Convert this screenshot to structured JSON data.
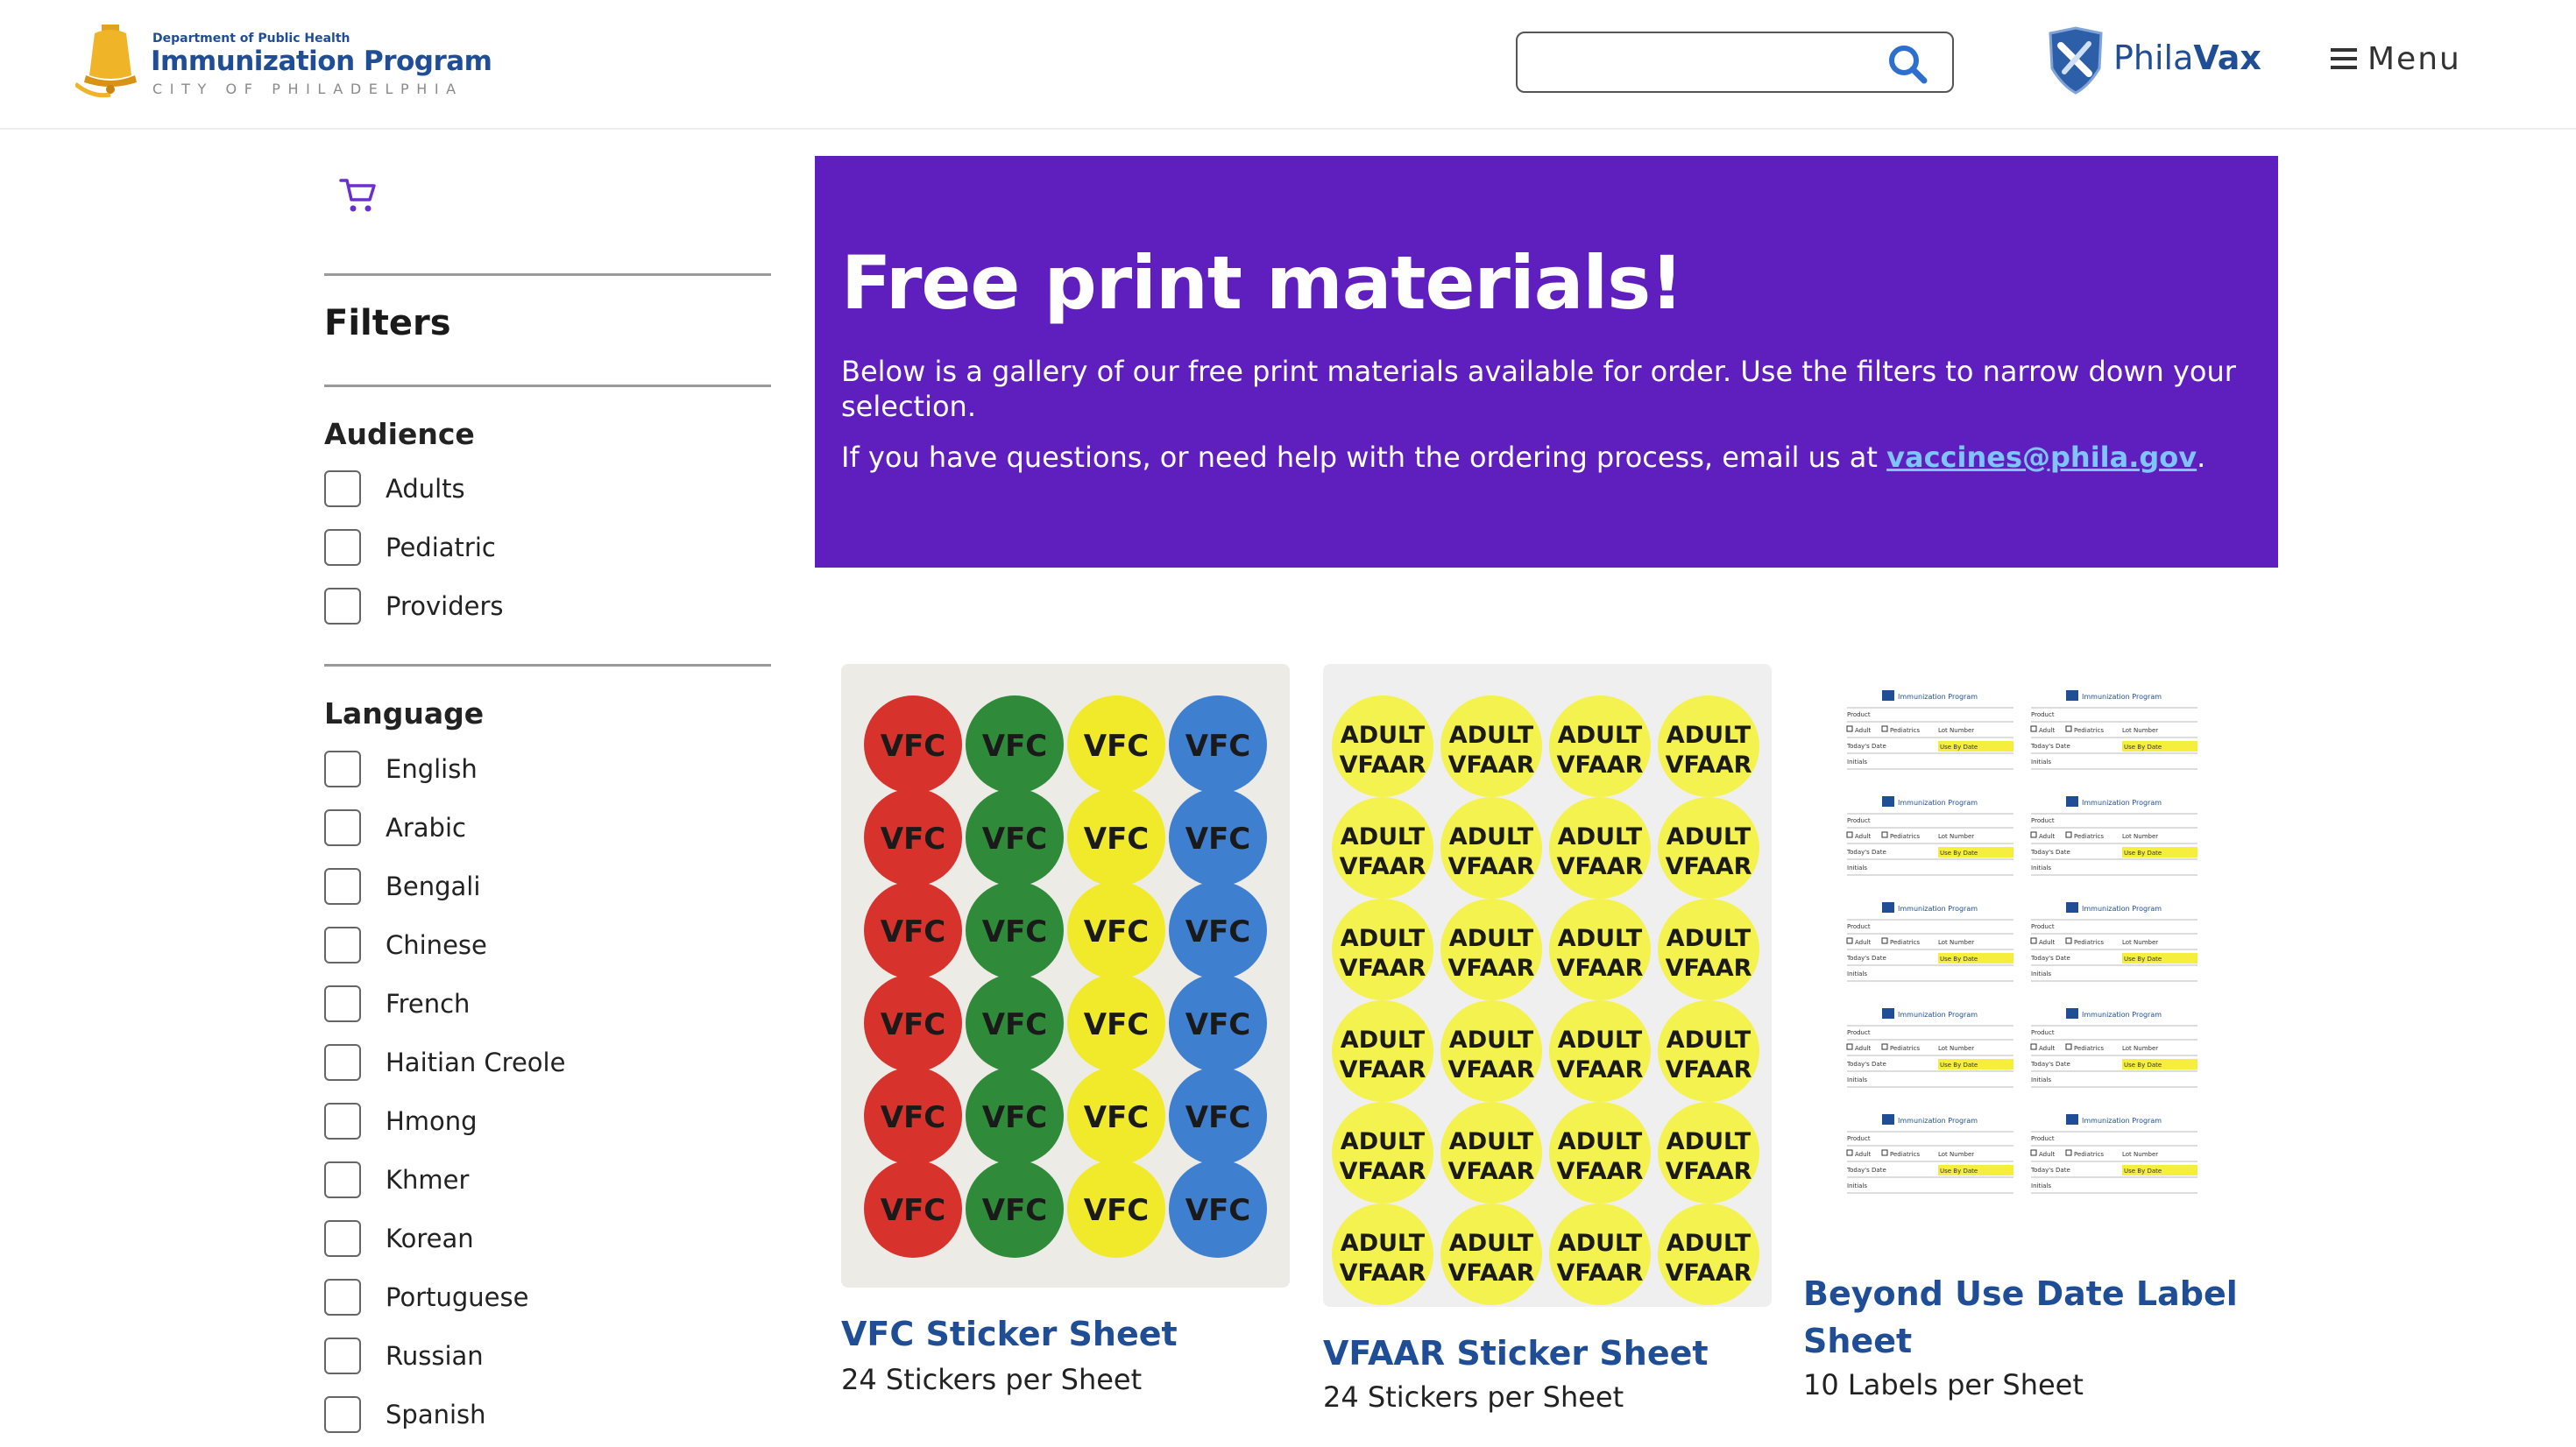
{
  "header": {
    "logo": {
      "department": "Department of Public Health",
      "program": "Immunization Program",
      "city": "CITY OF PHILADELPHIA"
    },
    "search": {
      "value": "",
      "placeholder": ""
    },
    "philavax": {
      "phila": "Phila",
      "vax": "Vax"
    },
    "menu_label": "Menu"
  },
  "sidebar": {
    "filters_title": "Filters",
    "audience": {
      "title": "Audience",
      "items": [
        "Adults",
        "Pediatric",
        "Providers"
      ]
    },
    "language": {
      "title": "Language",
      "items": [
        "English",
        "Arabic",
        "Bengali",
        "Chinese",
        "French",
        "Haitian Creole",
        "Hmong",
        "Khmer",
        "Korean",
        "Portuguese",
        "Russian",
        "Spanish"
      ]
    }
  },
  "hero": {
    "title": "Free print materials!",
    "paragraph1": "Below is a gallery of our free print materials available for order. Use the filters to narrow down your selection.",
    "paragraph2_prefix": "If you have questions, or need help with the ordering process, email us at ",
    "email": "vaccines@phila.gov",
    "paragraph2_suffix": "."
  },
  "products": [
    {
      "title": "VFC Sticker Sheet",
      "subtitle": "24 Stickers per Sheet",
      "sticker_text": "VFC"
    },
    {
      "title": "VFAAR Sticker Sheet",
      "subtitle": "24 Stickers per Sheet",
      "sticker_line1": "ADULT",
      "sticker_line2": "VFAAR"
    },
    {
      "title_line1": "Beyond Use Date Label",
      "title_line2": "Sheet",
      "subtitle": "10 Labels per Sheet",
      "label_fields": {
        "product": "Product",
        "adult": "Adult",
        "pediatrics": "Pediatrics",
        "lot": "Lot Number",
        "today": "Today's Date",
        "use_by": "Use By Date",
        "initials": "Initials",
        "program": "Immunization Program"
      }
    }
  ],
  "colors": {
    "brand_blue": "#1f4e96",
    "hero_purple": "#5f1fbf",
    "link_blue": "#7fc4ff",
    "vfc_red": "#d8322c",
    "vfc_green": "#2f8a3a",
    "vfc_yellow": "#f1ea2a",
    "vfc_blue": "#3f7fd0",
    "vfaar_yellow": "#f4f24e"
  }
}
